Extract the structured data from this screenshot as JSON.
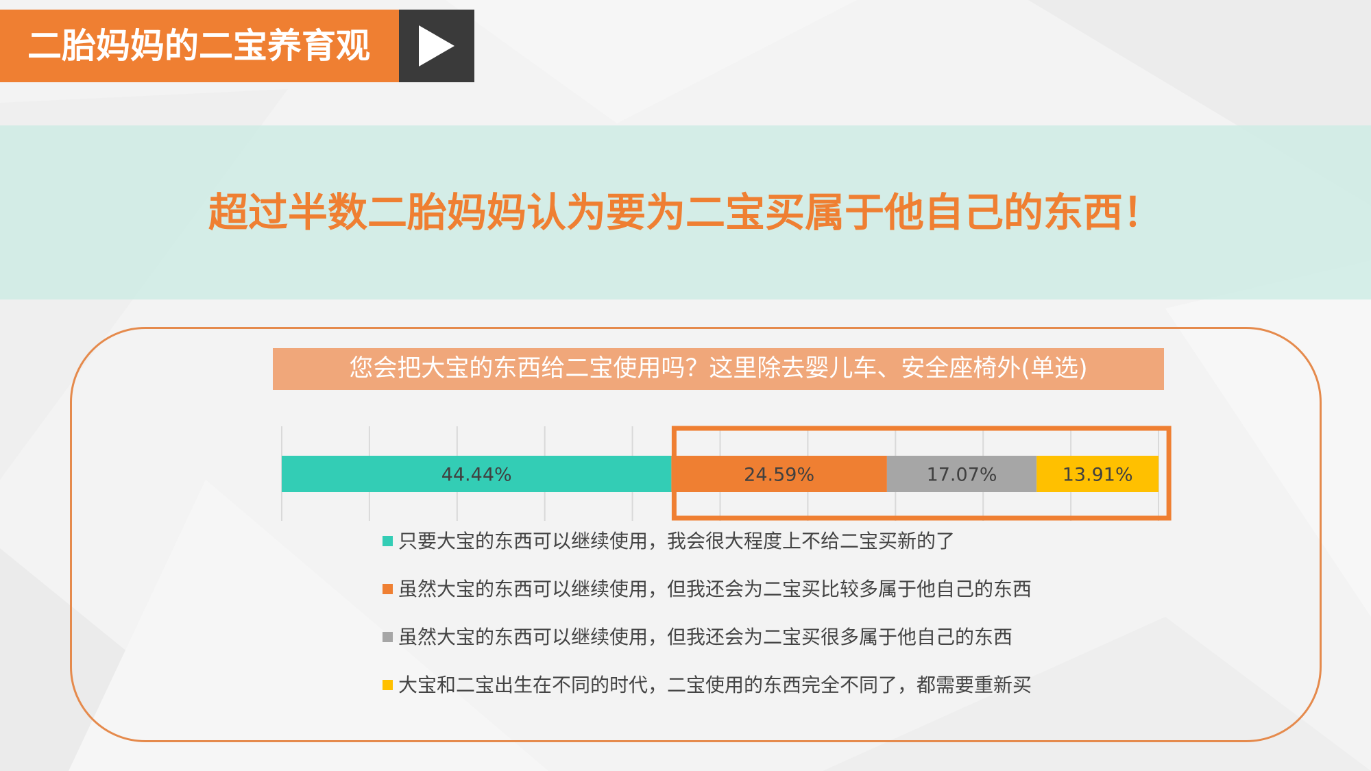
{
  "header": {
    "title": "二胎妈妈的二宝养育观"
  },
  "headline": "超过半数二胎妈妈认为要为二宝买属于他自己的东西！",
  "colors": {
    "accent": "#ef7f32",
    "band": "#cdece4",
    "dark": "#3a3a3a"
  },
  "chart_data": {
    "type": "bar",
    "orientation": "horizontal",
    "stacked": true,
    "title": "您会把大宝的东西给二宝使用吗？这里除去婴儿车、安全座椅外(单选)",
    "xlim": [
      0,
      100
    ],
    "grid": true,
    "legend_position": "bottom",
    "highlight_series": [
      1,
      2,
      3
    ],
    "series": [
      {
        "name": "只要大宝的东西可以继续使用，我会很大程度上不给二宝买新的了",
        "value": 44.44,
        "label": "44.44%",
        "color": "#33cdb5"
      },
      {
        "name": "虽然大宝的东西可以继续使用，但我还会为二宝买比较多属于他自己的东西",
        "value": 24.59,
        "label": "24.59%",
        "color": "#ef7f32"
      },
      {
        "name": "虽然大宝的东西可以继续使用，但我还会为二宝买很多属于他自己的东西",
        "value": 17.07,
        "label": "17.07%",
        "color": "#a6a6a6"
      },
      {
        "name": "大宝和二宝出生在不同的时代，二宝使用的东西完全不同了，都需要重新买",
        "value": 13.91,
        "label": "13.91%",
        "color": "#ffc000"
      }
    ]
  }
}
